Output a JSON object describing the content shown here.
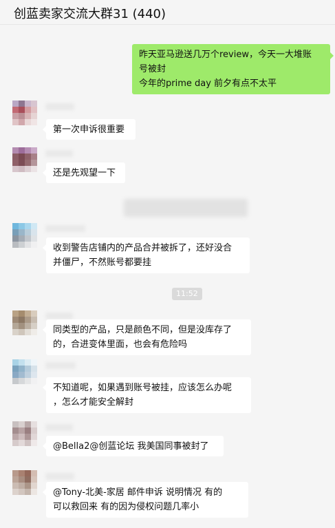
{
  "header": {
    "title": "创蓝卖家交流大群31 (440)"
  },
  "messages": [
    {
      "side": "right",
      "lines": [
        "昨天亚马逊送几万个review，今天一大堆账",
        "号被封",
        "今年的prime  day 前夕有点不太平"
      ]
    },
    {
      "side": "left",
      "avatar_colors": [
        "#b9a8c4",
        "#8e7691",
        "#c9b6cc",
        "#d8c5d0",
        "#c26a74",
        "#a94e5a",
        "#d39a9e",
        "#e1c0c3",
        "#c9a0a6",
        "#bb8f95",
        "#d8b4b6",
        "#e6d4d4",
        "#e0c4c6",
        "#d1a7ab",
        "#e9d7d7",
        "#f0e5e5"
      ],
      "lines": [
        "第一次申诉很重要"
      ]
    },
    {
      "side": "left",
      "avatar_colors": [
        "#b38bb0",
        "#9d6d9a",
        "#b58db3",
        "#caaac8",
        "#8b5d66",
        "#7a4a53",
        "#8e6169",
        "#a88088",
        "#8f6068",
        "#7c4d56",
        "#946a70",
        "#b4959a",
        "#d7c6cc",
        "#cfbcc2",
        "#ddd0d4",
        "#ebe3e5"
      ],
      "lines": [
        "还是先观望一下"
      ]
    },
    {
      "side": "left",
      "avatar_colors": [
        "#6fb7dd",
        "#8cc8e6",
        "#a9d7ee",
        "#d0e8f4",
        "#7a9fb8",
        "#9ab6c9",
        "#b9cdda",
        "#d9e4ec",
        "#8c95a0",
        "#a5adb6",
        "#c1c6cc",
        "#dfe2e5",
        "#b9bcc0",
        "#cdd0d3",
        "#e2e3e5",
        "#f0f0f1"
      ],
      "lines": [
        "收到警告店铺内的产品合并被拆了，还好没合",
        "并僵尸，不然账号都要挂"
      ]
    },
    {
      "side": "time",
      "text": "11:52"
    },
    {
      "side": "left",
      "avatar_colors": [
        "#b9a285",
        "#a58c6e",
        "#c2ae94",
        "#d8ccbd",
        "#9e8a76",
        "#8c7864",
        "#ab9a88",
        "#c7bcb0",
        "#b4a797",
        "#a2917f",
        "#bcb0a2",
        "#d6cfc6",
        "#d9d2c9",
        "#cfc6bb",
        "#e2ddd6",
        "#efece8"
      ],
      "lines": [
        "同类型的产品，只是颜色不同，但是没库存了",
        "的，合进变体里面，也会有危险吗"
      ]
    },
    {
      "side": "left",
      "avatar_colors": [
        "#a9d3e6",
        "#c3e0ee",
        "#dcecf4",
        "#eef5f9",
        "#7aa2bd",
        "#92b4cb",
        "#b4cbdb",
        "#d6e2ea",
        "#8aa9c4",
        "#a2bbd0",
        "#bfd0de",
        "#dde6ee",
        "#c6c9cc",
        "#d6d8da",
        "#e5e6e7",
        "#f1f1f2"
      ],
      "lines": [
        "不知道呢，如果遇到账号被挂，应该怎么办呢",
        "，怎么才能安全解封"
      ]
    },
    {
      "side": "left",
      "avatar_colors": [
        "#c8c0c0",
        "#d8d0cf",
        "#b9a9a9",
        "#e6dfdf",
        "#a48e8f",
        "#b8a3a4",
        "#9a7f81",
        "#d9cdcd",
        "#bca8a9",
        "#cdbcbd",
        "#ad9697",
        "#e1d7d7",
        "#d6cbcb",
        "#e2d9d9",
        "#cfc2c2",
        "#efe9e9"
      ],
      "lines": [
        "@Bella2@创蓝论坛 我美国同事被封了"
      ]
    },
    {
      "side": "left",
      "avatar_colors": [
        "#b89a8c",
        "#a98171",
        "#94685a",
        "#d4bdb2",
        "#bca598",
        "#a88d80",
        "#8f6d60",
        "#d7c5bb",
        "#cbbcb3",
        "#bfaea4",
        "#ab9588",
        "#e1d6cf",
        "#dcd2cc",
        "#d2c6bf",
        "#c4b6ad",
        "#ece6e2"
      ],
      "lines": [
        "@Tony-北美-家居 邮件申诉  说明情况  有的",
        "可以救回来   有的因为侵权问题几率小"
      ]
    }
  ]
}
